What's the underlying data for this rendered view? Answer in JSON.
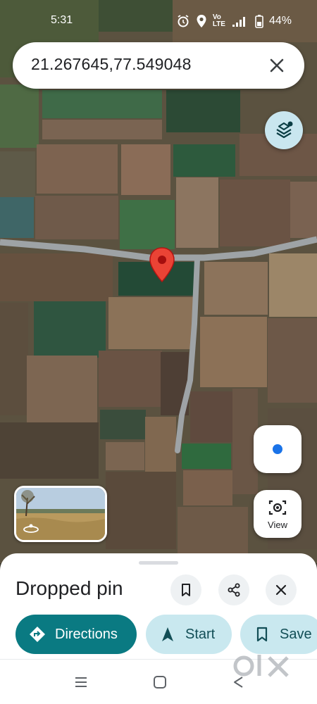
{
  "status_bar": {
    "time": "5:31",
    "battery": "44%"
  },
  "search": {
    "query": "21.267645,77.549048"
  },
  "map": {
    "pin_color": "#ea4335",
    "road_color": "#9ea3a6"
  },
  "floating": {
    "view_label": "View"
  },
  "place": {
    "title": "Dropped pin"
  },
  "actions": {
    "directions_label": "Directions",
    "start_label": "Start",
    "save_label": "Save"
  },
  "colors": {
    "primary": "#0a7a82",
    "secondary_bg": "#c9e8ef",
    "location_dot": "#1a73e8"
  }
}
